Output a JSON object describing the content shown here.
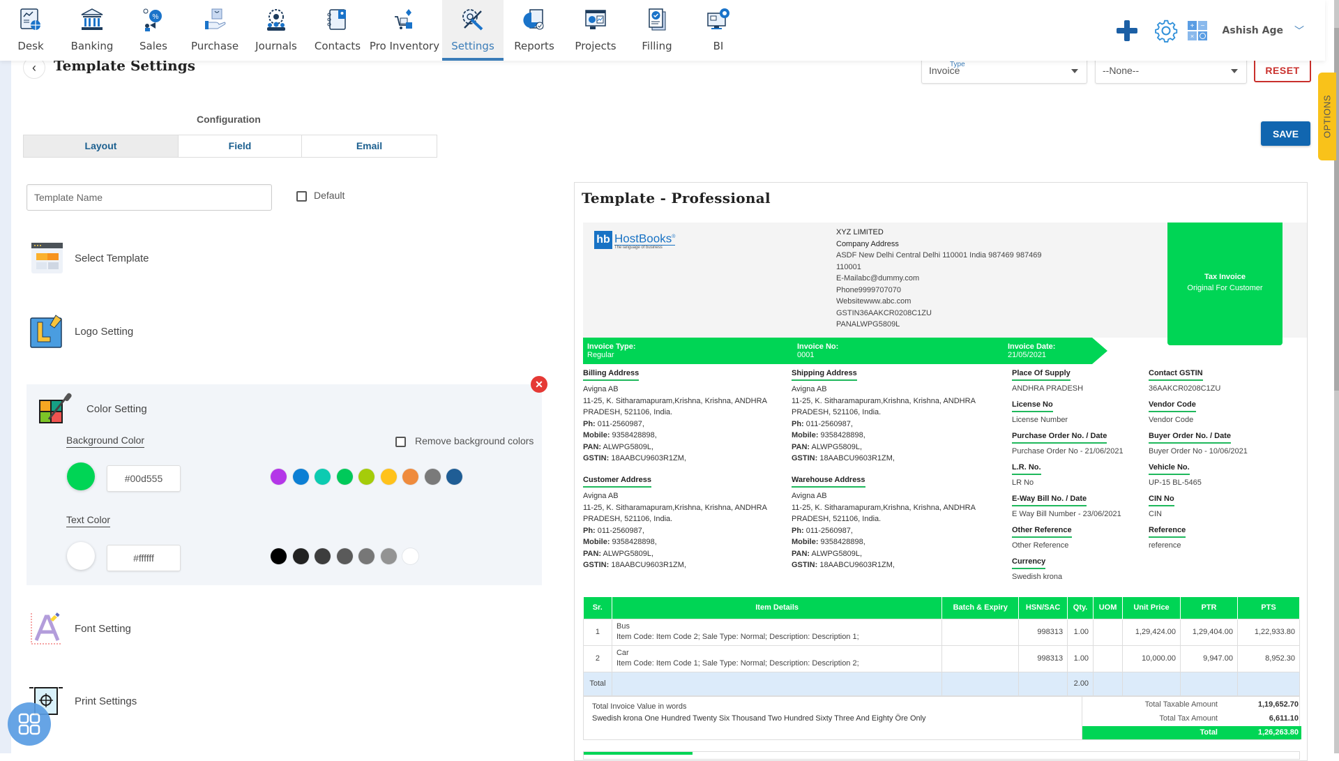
{
  "nav": {
    "items": [
      {
        "label": "Desk",
        "icon": "desk-icon"
      },
      {
        "label": "Banking",
        "icon": "bank-icon"
      },
      {
        "label": "Sales",
        "icon": "sales-icon"
      },
      {
        "label": "Purchase",
        "icon": "purchase-icon"
      },
      {
        "label": "Journals",
        "icon": "journals-icon"
      },
      {
        "label": "Contacts",
        "icon": "contacts-icon"
      },
      {
        "label": "Pro Inventory",
        "icon": "inventory-icon"
      },
      {
        "label": "Settings",
        "icon": "settings-icon",
        "active": true
      },
      {
        "label": "Reports",
        "icon": "reports-icon"
      },
      {
        "label": "Projects",
        "icon": "projects-icon"
      },
      {
        "label": "Filling",
        "icon": "filling-icon"
      },
      {
        "label": "BI",
        "icon": "bi-icon"
      }
    ],
    "user_name": "Ashish Age",
    "user_chevron": "﹀"
  },
  "page": {
    "title": "Template Settings",
    "back": "‹",
    "type_select": {
      "label": "Type",
      "value": "Invoice"
    },
    "sub_select": {
      "value": "--None--"
    },
    "reset_label": "RESET",
    "save_label": "SAVE",
    "options_label": "OPTIONS"
  },
  "config": {
    "label": "Configuration",
    "tabs": [
      {
        "label": "Layout",
        "active": true
      },
      {
        "label": "Field"
      },
      {
        "label": "Email"
      }
    ],
    "template_name_placeholder": "Template Name",
    "template_name_value": "",
    "default_label": "Default",
    "default_checked": false
  },
  "settings": {
    "select_template": "Select Template",
    "logo_setting": "Logo Setting",
    "color_setting": "Color Setting",
    "font_setting": "Font Setting",
    "print_settings": "Print Settings"
  },
  "color": {
    "close": "✕",
    "background_label": "Background Color",
    "background_value": "#00d555",
    "remove_bg_label": "Remove background colors",
    "remove_bg_checked": false,
    "background_swatches": [
      "#b436e8",
      "#0c7fd4",
      "#0ccbb1",
      "#00c95a",
      "#a5cc0a",
      "#ffc21c",
      "#ef8b3d",
      "#7a7a7a",
      "#1f5d95"
    ],
    "text_label": "Text Color",
    "text_value": "#ffffff",
    "text_swatches": [
      "#000000",
      "#222222",
      "#3d3d3d",
      "#5a5a5a",
      "#777777",
      "#939393",
      "#ffffff"
    ]
  },
  "preview": {
    "title": "Template - Professional",
    "logo": {
      "mark": "hb",
      "name": "HostBooks",
      "reg": "®",
      "tagline": "The language of business"
    },
    "company": {
      "name": "XYZ LIMITED",
      "address_label": "Company Address",
      "address_line1": "ASDF New Delhi Central Delhi 110001 India 987469 987469",
      "address_line2": "110001",
      "email": "E-Mailabc@dummy.com",
      "phone": "Phone9999707070",
      "website": "Websitewww.abc.com",
      "gstin": "GSTIN36AAKCR0208C1ZU",
      "pan": "PANALWPG5809L"
    },
    "tax_box": {
      "title": "Tax Invoice",
      "subtitle": "Original For Customer"
    },
    "band": {
      "type_label": "Invoice Type:",
      "type_value": "Regular",
      "no_label": "Invoice No:",
      "no_value": "0001",
      "date_label": "Invoice Date:",
      "date_value": "21/05/2021"
    },
    "addresses": [
      {
        "title": "Billing Address",
        "name": "Avigna AB",
        "line1": "11-25, K. Sitharamapuram,Krishna, Krishna, ANDHRA",
        "line2": "PRADESH, 521106, India.",
        "ph_label": "Ph:",
        "ph": " 011-2560987,",
        "mobile_label": "Mobile:",
        "mobile": " 9358428898,",
        "pan_label": "PAN:",
        "pan": " ALWPG5809L,",
        "gstin_label": "GSTIN:",
        "gstin": " 18AABCU9603R1ZM,"
      },
      {
        "title": "Shipping Address",
        "name": "Avigna AB",
        "line1": "11-25, K. Sitharamapuram,Krishna, Krishna, ANDHRA",
        "line2": "PRADESH, 521106, India.",
        "ph_label": "Ph:",
        "ph": " 011-2560987,",
        "mobile_label": "Mobile:",
        "mobile": " 9358428898,",
        "pan_label": "PAN:",
        "pan": " ALWPG5809L,",
        "gstin_label": "GSTIN:",
        "gstin": " 18AABCU9603R1ZM,"
      },
      {
        "title": "Customer Address",
        "name": "Avigna AB",
        "line1": "11-25, K. Sitharamapuram,Krishna, Krishna, ANDHRA",
        "line2": "PRADESH, 521106, India.",
        "ph_label": "Ph:",
        "ph": " 011-2560987,",
        "mobile_label": "Mobile:",
        "mobile": " 9358428898,",
        "pan_label": "PAN:",
        "pan": " ALWPG5809L,",
        "gstin_label": "GSTIN:",
        "gstin": " 18AABCU9603R1ZM,"
      },
      {
        "title": "Warehouse Address",
        "name": "Avigna AB",
        "line1": "11-25, K. Sitharamapuram,Krishna, Krishna, ANDHRA",
        "line2": "PRADESH, 521106, India.",
        "ph_label": "Ph:",
        "ph": " 011-2560987,",
        "mobile_label": "Mobile:",
        "mobile": " 9358428898,",
        "pan_label": "PAN:",
        "pan": " ALWPG5809L,",
        "gstin_label": "GSTIN:",
        "gstin": " 18AABCU9603R1ZM,"
      }
    ],
    "fields_left": [
      {
        "label": "Place Of Supply",
        "value": "ANDHRA PRADESH"
      },
      {
        "label": "License No",
        "value": "License Number"
      },
      {
        "label": "Purchase Order No. / Date",
        "value": "Purchase Order No - 21/06/2021"
      },
      {
        "label": "L.R. No.",
        "value": "LR No"
      },
      {
        "label": "E-Way Bill No. / Date",
        "value": "E Way Bill Number - 23/06/2021"
      },
      {
        "label": "Other Reference",
        "value": "Other Reference"
      },
      {
        "label": "Currency",
        "value": "Swedish krona"
      }
    ],
    "fields_right": [
      {
        "label": "Contact GSTIN",
        "value": "36AAKCR0208C1ZU"
      },
      {
        "label": "Vendor Code",
        "value": "Vendor Code"
      },
      {
        "label": "Buyer Order No. / Date",
        "value": "Buyer Order No - 10/06/2021"
      },
      {
        "label": "Vehicle No.",
        "value": "UP-15 BL-5465"
      },
      {
        "label": "CIN No",
        "value": "CIN"
      },
      {
        "label": "Reference",
        "value": "reference"
      }
    ],
    "table": {
      "headers": [
        "Sr.",
        "Item Details",
        "Batch & Expiry",
        "HSN/SAC",
        "Qty.",
        "UOM",
        "Unit Price",
        "PTR",
        "PTS"
      ],
      "rows": [
        {
          "sr": "1",
          "name": "Bus",
          "details": "Item Code: Item Code 2; Sale Type: Normal; Description: Description 1;",
          "batch": "",
          "hsn": "998313",
          "qty": "1.00",
          "uom": "",
          "unit_price": "1,29,424.00",
          "ptr": "1,29,404.00",
          "pts": "1,22,933.80"
        },
        {
          "sr": "2",
          "name": "Car",
          "details": "Item Code: Item Code 1; Sale Type: Normal; Description: Description 2;",
          "batch": "",
          "hsn": "998313",
          "qty": "1.00",
          "uom": "",
          "unit_price": "10,000.00",
          "ptr": "9,947.00",
          "pts": "8,952.30"
        }
      ],
      "total_label": "Total",
      "total_qty": "2.00"
    },
    "summary": {
      "words_label": "Total Invoice Value in words",
      "words_value": "Swedish krona One Hundred Twenty Six Thousand Two Hundred Sixty Three And Eighty Öre Only",
      "taxable_label": "Total Taxable Amount",
      "taxable_value": "1,19,652.70",
      "tax_label": "Total Tax Amount",
      "tax_value": "6,611.10",
      "total_label": "Total",
      "total_value": "1,26,263.80"
    }
  }
}
